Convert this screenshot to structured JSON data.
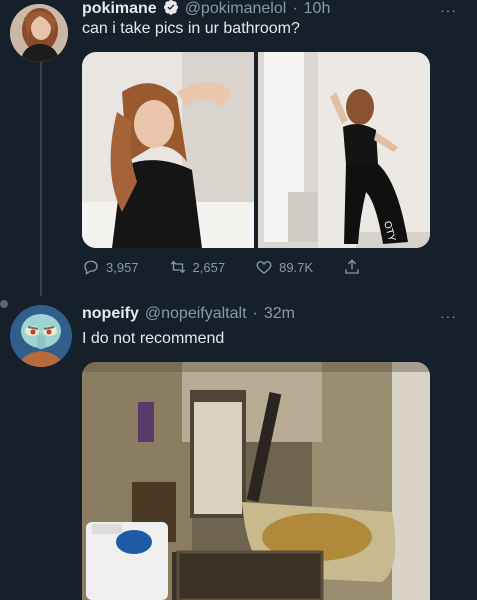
{
  "tweet1": {
    "name": "pokimane",
    "handle": "@pokimanelol",
    "separator": "·",
    "time": "10h",
    "text": "can i take pics in ur bathroom?",
    "more": "···",
    "actions": {
      "replies": "3,957",
      "retweets": "2,657",
      "likes": "89.7K"
    }
  },
  "tweet2": {
    "name": "nopeify",
    "handle": "@nopeifyaltalt",
    "separator": "·",
    "time": "32m",
    "text": "I do not recommend",
    "more": "···"
  },
  "icons": {
    "verified": "verified-badge-icon",
    "reply": "reply-icon",
    "retweet": "retweet-icon",
    "like": "heart-icon",
    "share": "share-icon"
  },
  "colors": {
    "background": "#15202b",
    "secondary_text": "#8899a6",
    "verified_blue": "#1d9bf0"
  }
}
